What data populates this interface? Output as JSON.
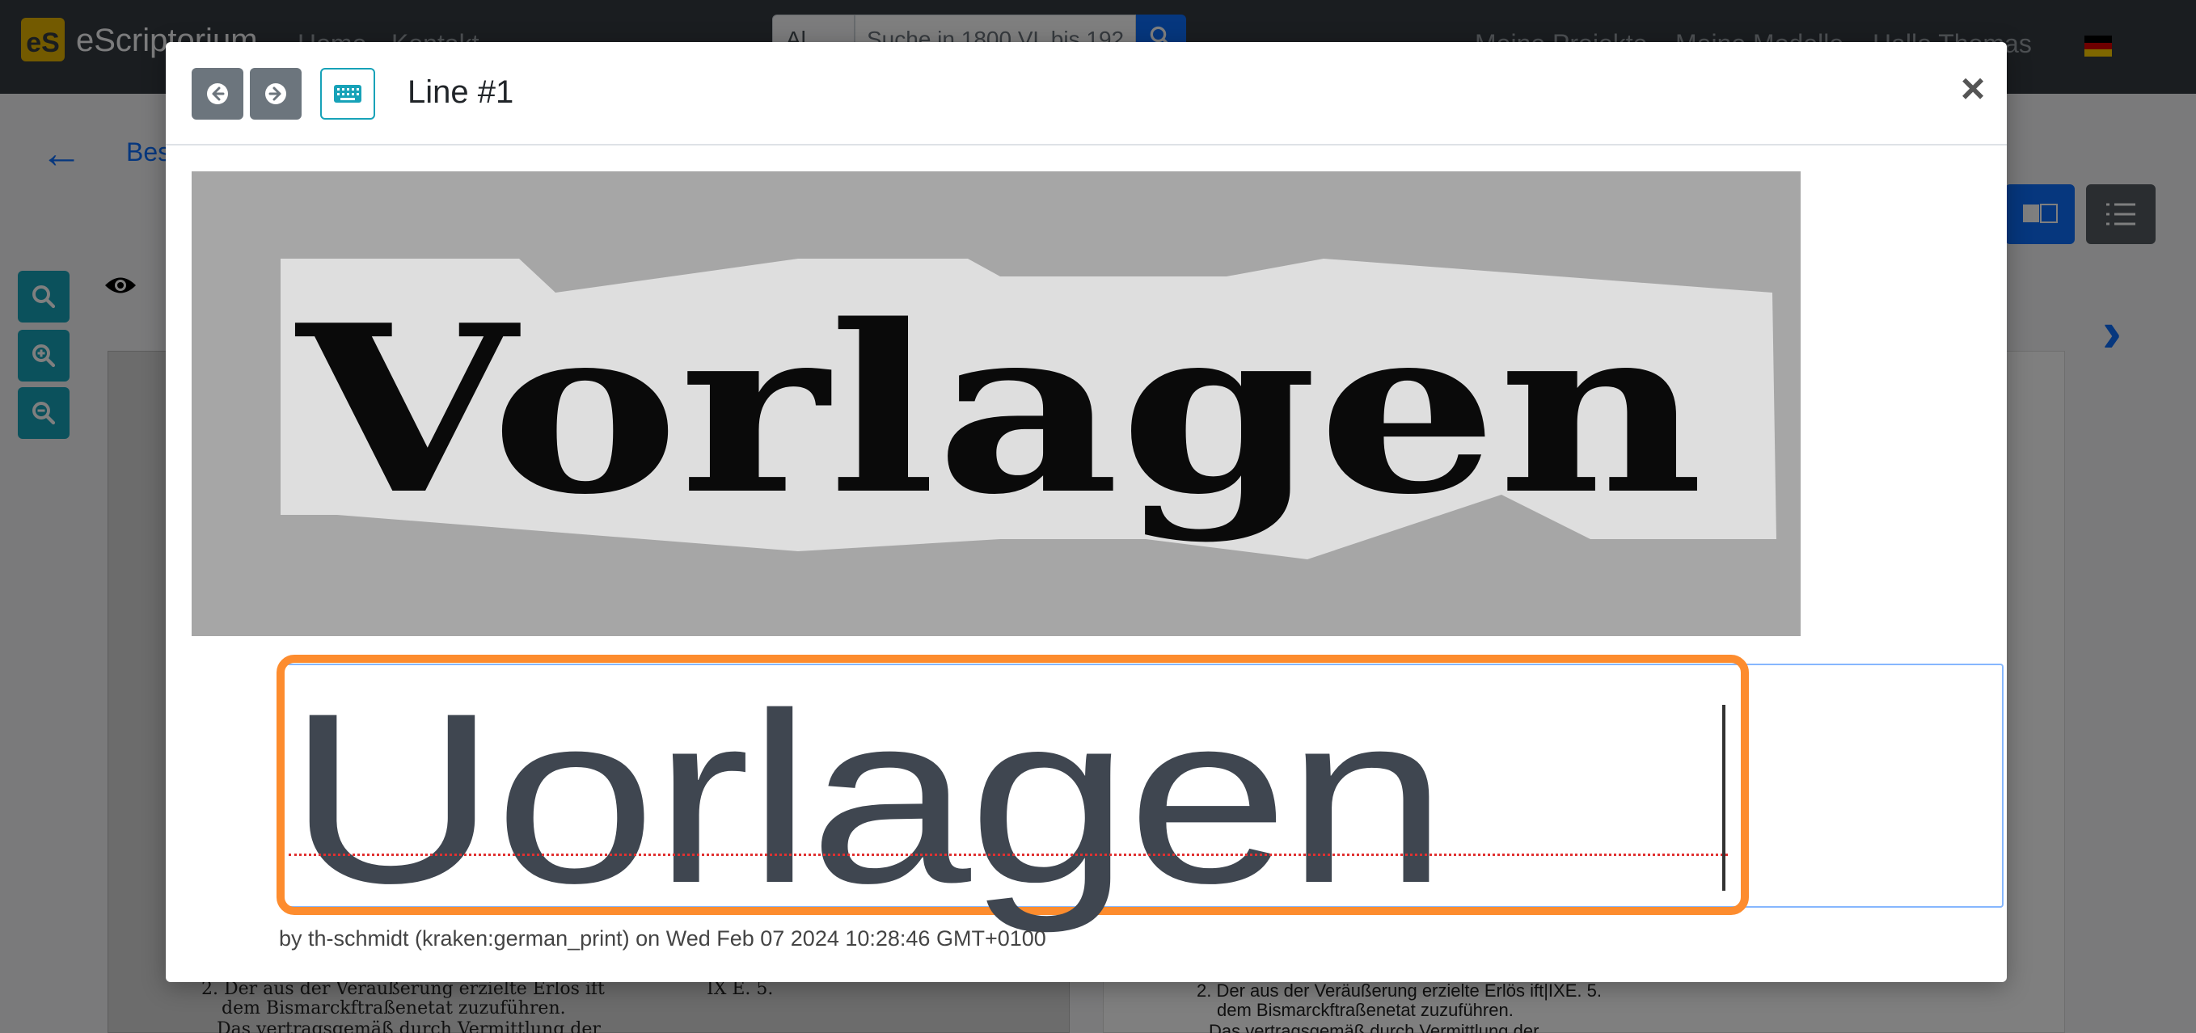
{
  "app": {
    "brand_logo": "eS",
    "brand_name": "eScriptorium",
    "nav": [
      "Home",
      "Kontakt"
    ],
    "search_scope": "Al",
    "search_placeholder": "Suche in 1800 VL bis 192",
    "nav_right": [
      "Meine Projekte",
      "Meine Modelle",
      "Hallo Thomas"
    ],
    "breadcrumb": "Bes"
  },
  "document_snippets": {
    "left": [
      "2. Der aus der Veräußerung erzielte Erlös ift",
      "dem Bismarckftraßenetat zuzuführen.",
      "Das vertragsgemäß durch Vermittlung der",
      "IX E. 5."
    ],
    "right": [
      "2. Der aus der Veräußerung erzielte Erlös ift|IXE. 5.",
      "dem Bismarckftraßenetat zuzuführen.",
      "Das vertragsgemäß durch Vermittlung der"
    ]
  },
  "modal": {
    "title": "Line #1",
    "line_image_text": "Vorlagen",
    "transcription": "Uorlagen",
    "meta": "by th-schmidt (kraken:german_print) on Wed Feb 07 2024 10:28:46 GMT+0100"
  },
  "icons": [
    "arrow-left-circle-icon",
    "arrow-right-circle-icon",
    "keyboard-icon",
    "close-icon",
    "search-icon",
    "zoom-in-icon",
    "zoom-out-icon",
    "eye-icon",
    "chevron-right-icon",
    "list-icon",
    "translate-icon",
    "flag-de-icon"
  ],
  "colors": {
    "navbar": "#343a40",
    "primary": "#0d6efd",
    "info": "#17a2b8",
    "highlight": "#fd8c2e",
    "focus_border": "#86b7fe"
  }
}
